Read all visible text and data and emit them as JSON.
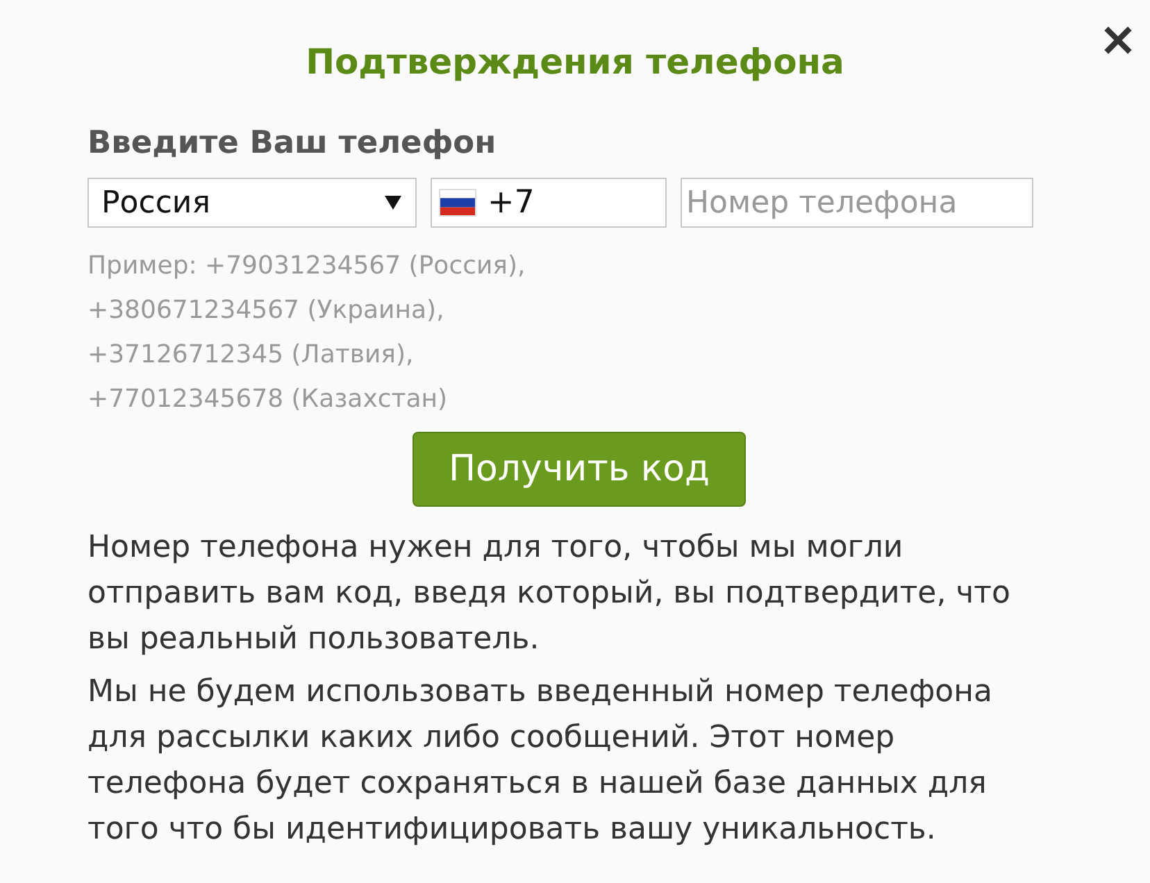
{
  "dialog": {
    "title": "Подтверждения телефона"
  },
  "phone_form": {
    "label": "Введите Ваш телефон",
    "country_select": {
      "value": "Россия"
    },
    "country_code": {
      "value": "+7"
    },
    "number_field": {
      "placeholder": "Номер телефона"
    }
  },
  "example_lines": [
    "Пример: +79031234567 (Россия),",
    "+380671234567 (Украина),",
    "+37126712345 (Латвия),",
    "+77012345678 (Казахстан)"
  ],
  "submit_button": "Получить код",
  "notes": [
    "Номер телефона нужен для того, чтобы мы могли отправить вам код, введя который, вы подтвердите, что вы реальный пользователь.",
    "Мы не будем использовать введенный номер телефона для рассылки каких либо сообщений. Этот номер телефона будет сохраняться в нашей базе данных для того что бы идентифицировать вашу уникальность."
  ]
}
